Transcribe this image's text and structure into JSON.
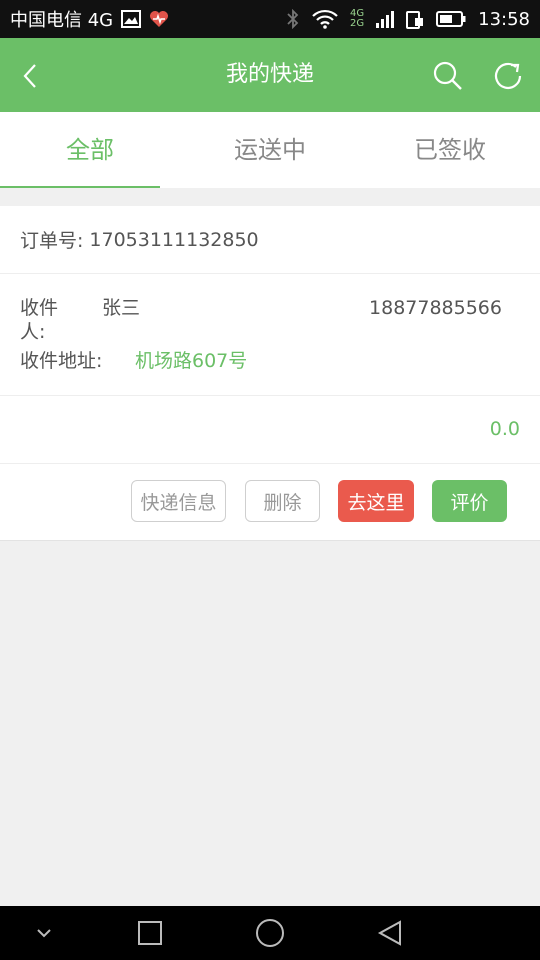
{
  "status_bar": {
    "carrier": "中国电信 4G",
    "net_top": "4G",
    "net_bottom": "2G",
    "time": "13:58"
  },
  "app_bar": {
    "title": "我的快递",
    "back_icon": "chevron-left-icon",
    "search_icon": "search-icon",
    "refresh_icon": "refresh-icon"
  },
  "tabs": [
    {
      "label": "全部",
      "active": true
    },
    {
      "label": "运送中",
      "active": false
    },
    {
      "label": "已签收",
      "active": false
    }
  ],
  "order": {
    "order_no_label": "订单号:",
    "order_no": "17053111132850",
    "recipient_label": "收件人:",
    "recipient_name": "张三",
    "recipient_phone": "18877885566",
    "address_label": "收件地址:",
    "address": "机场路607号",
    "amount": "0.0",
    "buttons": {
      "express_info": "快递信息",
      "delete": "删除",
      "go_here": "去这里",
      "review": "评价"
    }
  },
  "colors": {
    "accent": "#6bbf67",
    "danger": "#ea5a4d"
  }
}
